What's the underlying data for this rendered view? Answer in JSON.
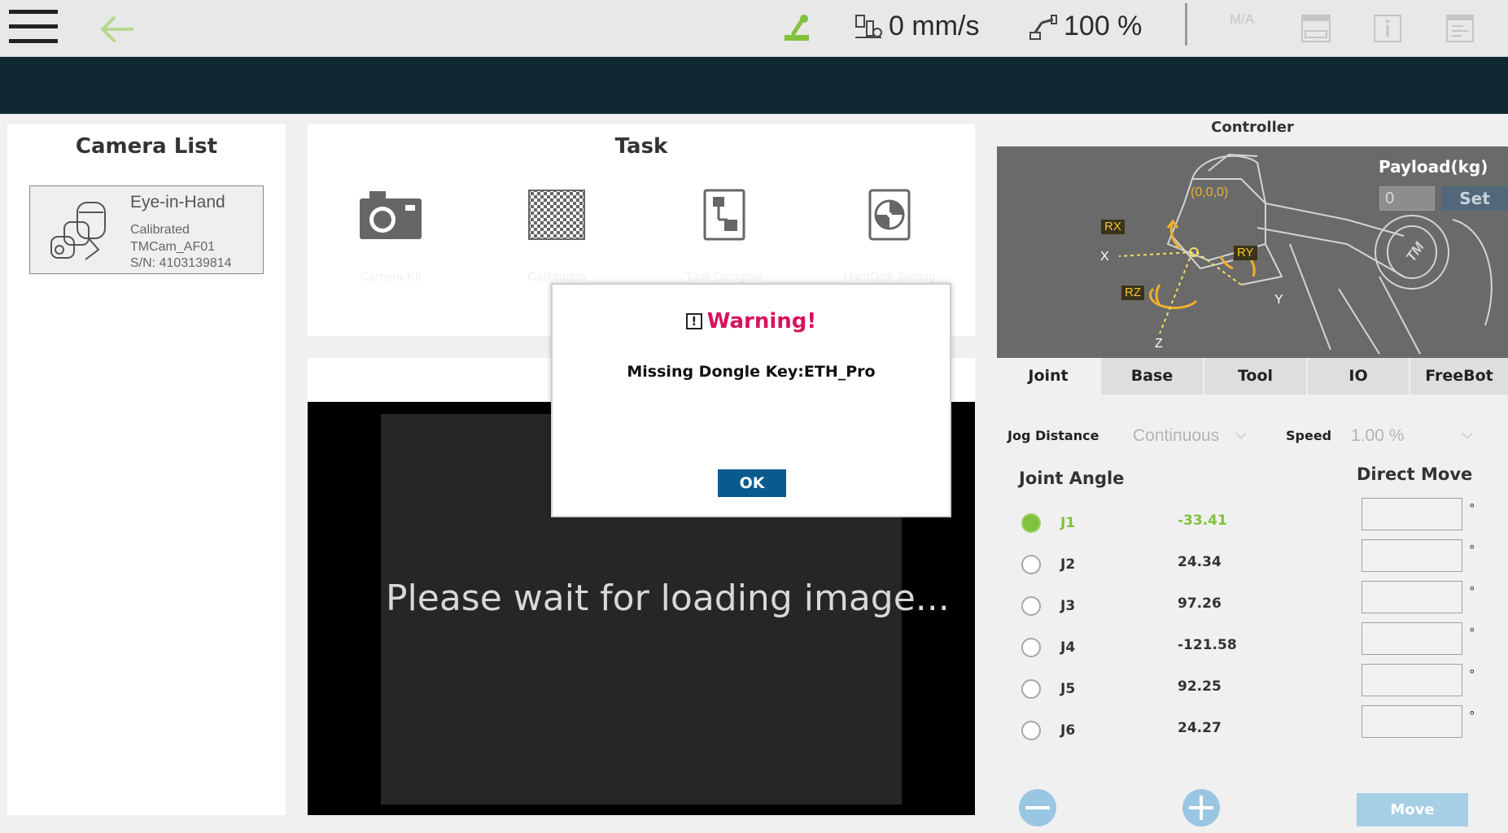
{
  "topbar": {
    "speed": "0 mm/s",
    "percent": "100 %",
    "mode_icon_text": "M/A"
  },
  "camera_list": {
    "title": "Camera List",
    "camera": {
      "name": "Eye-in-Hand",
      "status": "Calibrated",
      "model": "TMCam_AF01",
      "serial": "S/N: 4103139814"
    }
  },
  "task": {
    "title": "Task",
    "items": [
      {
        "label": "Camera Kit",
        "icon": "camera-icon"
      },
      {
        "label": "Calibration",
        "icon": "checkerboard-icon"
      },
      {
        "label": "Task Designer",
        "icon": "flow-icon"
      },
      {
        "label": "HardDisk Setting",
        "icon": "harddisk-icon"
      }
    ]
  },
  "viewer": {
    "loading": "Please wait for loading image..."
  },
  "modal": {
    "title": "Warning!",
    "warn_glyph": "!",
    "message": "Missing Dongle Key:ETH_Pro",
    "ok": "OK"
  },
  "controller": {
    "title": "Controller",
    "payload_label": "Payload(kg)",
    "payload_value": "0",
    "set": "Set",
    "axes": {
      "origin": "(0,0,0)",
      "rx": "RX",
      "ry": "RY",
      "rz": "RZ",
      "x": "X",
      "y": "Y",
      "z": "Z",
      "logo": "TM"
    },
    "tabs": [
      "Joint",
      "Base",
      "Tool",
      "IO",
      "FreeBot"
    ],
    "jog_distance_label": "Jog Distance",
    "jog_distance_value": "Continuous",
    "speed_label": "Speed",
    "speed_value": "1.00 %",
    "joint_angle_title": "Joint Angle",
    "direct_move_title": "Direct Move",
    "joints": [
      {
        "name": "J1",
        "value": "-33.41",
        "selected": true
      },
      {
        "name": "J2",
        "value": "24.34",
        "selected": false
      },
      {
        "name": "J3",
        "value": "97.26",
        "selected": false
      },
      {
        "name": "J4",
        "value": "-121.58",
        "selected": false
      },
      {
        "name": "J5",
        "value": "92.25",
        "selected": false
      },
      {
        "name": "J6",
        "value": "24.27",
        "selected": false
      }
    ],
    "degree_symbol": "°",
    "move": "Move"
  },
  "colors": {
    "accent_green": "#7fc23c",
    "warning_red": "#d6145c",
    "ok_blue": "#0a5a8e",
    "header_dark": "#0f2832"
  }
}
